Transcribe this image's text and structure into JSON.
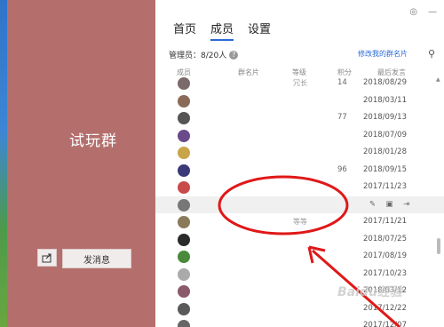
{
  "group_name": "试玩群",
  "send_label": "发消息",
  "tabs": [
    {
      "label": "首页",
      "active": false
    },
    {
      "label": "成员",
      "active": true
    },
    {
      "label": "设置",
      "active": false
    }
  ],
  "manager_info": "管理员：8/20人",
  "edit_card_link": "修改我的群名片",
  "columns": {
    "member": "成员",
    "card": "群名片",
    "level": "等级",
    "points": "积分",
    "last_msg": "最后发言"
  },
  "rows": [
    {
      "name": "",
      "card": "",
      "level": "冗长",
      "points": "14",
      "date": "2018/08/29",
      "color": "#7a6a6a",
      "highlight": false
    },
    {
      "name": "",
      "card": "",
      "level": "",
      "points": "",
      "date": "2018/03/11",
      "color": "#8a6b58",
      "highlight": false
    },
    {
      "name": "",
      "card": "",
      "level": "",
      "points": "77",
      "date": "2018/09/13",
      "color": "#555",
      "highlight": false
    },
    {
      "name": "",
      "card": "",
      "level": "",
      "points": "",
      "date": "2018/07/09",
      "color": "#6a4a8a",
      "highlight": false
    },
    {
      "name": "",
      "card": "",
      "level": "",
      "points": "",
      "date": "2018/01/28",
      "color": "#c9a54a",
      "highlight": false
    },
    {
      "name": "",
      "card": "",
      "level": "",
      "points": "96",
      "date": "2018/09/15",
      "color": "#3a3a7a",
      "highlight": false
    },
    {
      "name": "",
      "card": "",
      "level": "",
      "points": "",
      "date": "2017/11/23",
      "color": "#c94a4a",
      "highlight": false
    },
    {
      "name": "",
      "card": "",
      "level": "",
      "points": "",
      "date": "",
      "color": "#777",
      "highlight": true
    },
    {
      "name": "",
      "card": "",
      "level": "等等",
      "points": "",
      "date": "2017/11/21",
      "color": "#8a7a5a",
      "highlight": false
    },
    {
      "name": "",
      "card": "",
      "level": "",
      "points": "",
      "date": "2018/07/25",
      "color": "#2a2a2a",
      "highlight": false
    },
    {
      "name": "",
      "card": "",
      "level": "",
      "points": "",
      "date": "2017/08/19",
      "color": "#4a8a3a",
      "highlight": false
    },
    {
      "name": "",
      "card": "",
      "level": "",
      "points": "",
      "date": "2017/10/23",
      "color": "#aaa",
      "highlight": false
    },
    {
      "name": "",
      "card": "",
      "level": "",
      "points": "",
      "date": "2018/03/12",
      "color": "#8a5a6a",
      "highlight": false
    },
    {
      "name": "",
      "card": "",
      "level": "",
      "points": "",
      "date": "2017/12/22",
      "color": "#5a5a5a",
      "highlight": false
    },
    {
      "name": "",
      "card": "",
      "level": "",
      "points": "",
      "date": "2017/12/07",
      "color": "#666",
      "highlight": false
    }
  ],
  "watermark": "Baidu经验",
  "colors": {
    "left_panel": "#b46f6d",
    "accent": "#2a6ad6",
    "annotation": "#e01818"
  }
}
